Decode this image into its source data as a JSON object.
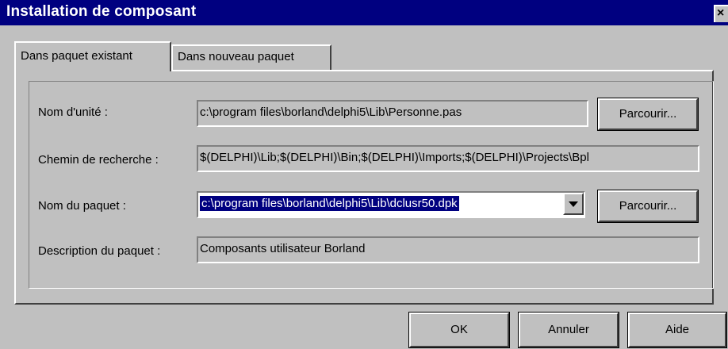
{
  "window": {
    "title": "Installation de composant",
    "close_glyph": "×"
  },
  "tabs": [
    {
      "label": "Dans paquet existant",
      "active": true
    },
    {
      "label": "Dans nouveau paquet",
      "active": false
    }
  ],
  "fields": {
    "unit_name": {
      "label": "Nom d'unité :",
      "value": "c:\\program files\\borland\\delphi5\\Lib\\Personne.pas"
    },
    "search_path": {
      "label": "Chemin de recherche :",
      "value": "$(DELPHI)\\Lib;$(DELPHI)\\Bin;$(DELPHI)\\Imports;$(DELPHI)\\Projects\\Bpl"
    },
    "package_name": {
      "label": "Nom du paquet :",
      "value": "c:\\program files\\borland\\delphi5\\Lib\\dclusr50.dpk"
    },
    "package_description": {
      "label": "Description du paquet :",
      "value": "Composants utilisateur Borland"
    }
  },
  "buttons": {
    "browse_unit": "Parcourir...",
    "browse_package": "Parcourir...",
    "ok": "OK",
    "cancel": "Annuler",
    "help": "Aide"
  },
  "colors": {
    "title_bar": "#000080",
    "face": "#c0c0c0",
    "selection": "#000080"
  },
  "icons": {
    "combo_arrow": "chevron-down-icon",
    "close": "close-icon"
  }
}
